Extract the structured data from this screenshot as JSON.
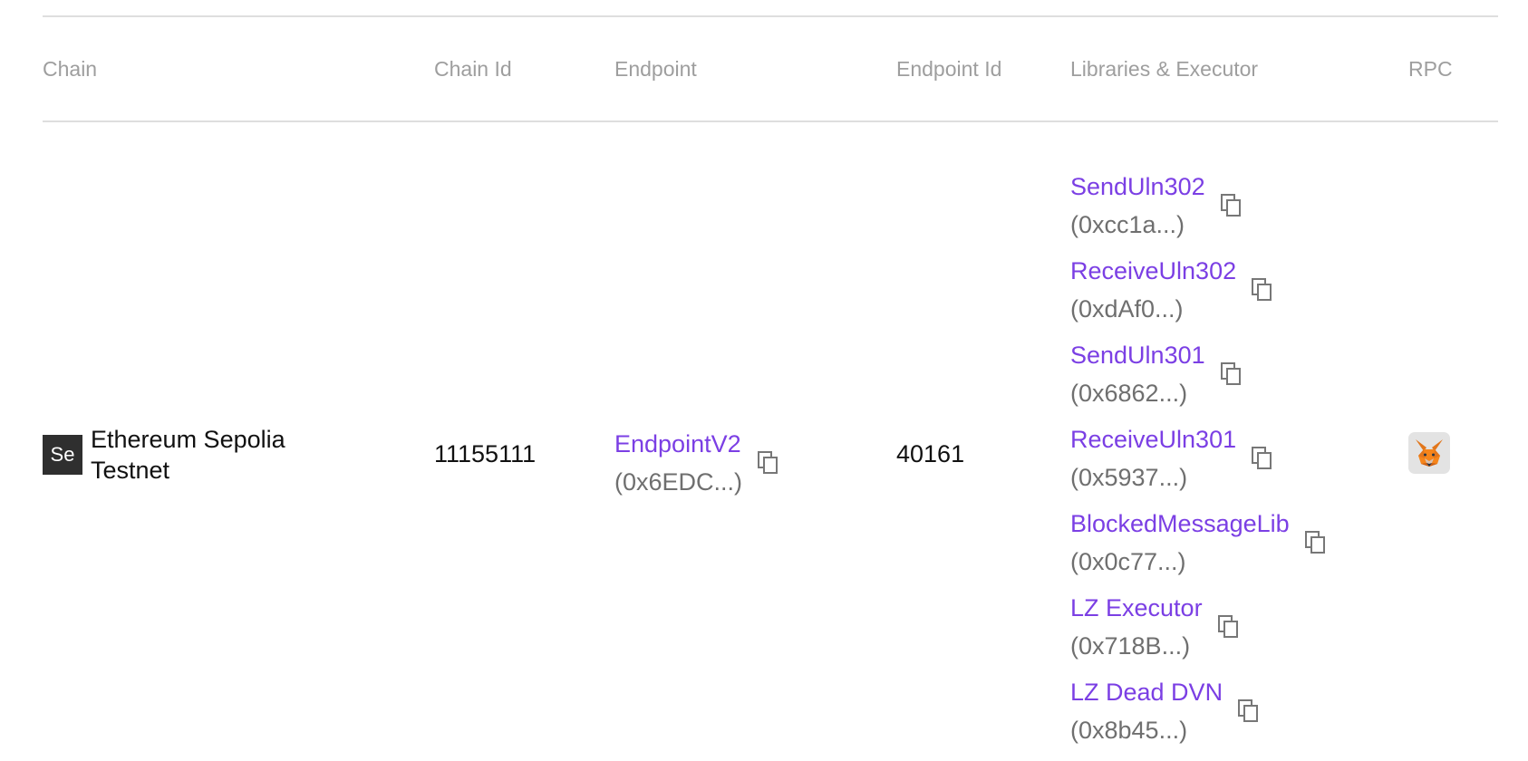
{
  "table": {
    "headers": {
      "chain": "Chain",
      "chain_id": "Chain Id",
      "endpoint": "Endpoint",
      "endpoint_id": "Endpoint Id",
      "libraries": "Libraries & Executor",
      "rpc": "RPC"
    },
    "row": {
      "chain_avatar": "Se",
      "chain_name": "Ethereum Sepolia Testnet",
      "chain_id": "11155111",
      "endpoint": {
        "name": "EndpointV2",
        "address": "(0x6EDC...)",
        "icon": "copy-icon"
      },
      "endpoint_id": "40161",
      "libraries": [
        {
          "name": "SendUln302",
          "address": "(0xcc1a...)",
          "icon": "copy-icon"
        },
        {
          "name": "ReceiveUln302",
          "address": "(0xdAf0...)",
          "icon": "copy-icon"
        },
        {
          "name": "SendUln301",
          "address": "(0x6862...)",
          "icon": "copy-icon"
        },
        {
          "name": "ReceiveUln301",
          "address": "(0x5937...)",
          "icon": "copy-icon"
        },
        {
          "name": "BlockedMessageLib",
          "address": "(0x0c77...)",
          "icon": "copy-icon"
        },
        {
          "name": "LZ Executor",
          "address": "(0x718B...)",
          "icon": "copy-icon"
        },
        {
          "name": "LZ Dead DVN",
          "address": "(0x8b45...)",
          "icon": "copy-icon"
        }
      ],
      "rpc_icon": "metamask-fox-icon"
    }
  },
  "colors": {
    "link": "#7b3fe4",
    "address": "#6f6f6f",
    "header_text": "#9e9e9e",
    "divider": "#dedede",
    "avatar_bg": "#2f2f2f",
    "rpc_button_bg": "#e3e3e3"
  }
}
